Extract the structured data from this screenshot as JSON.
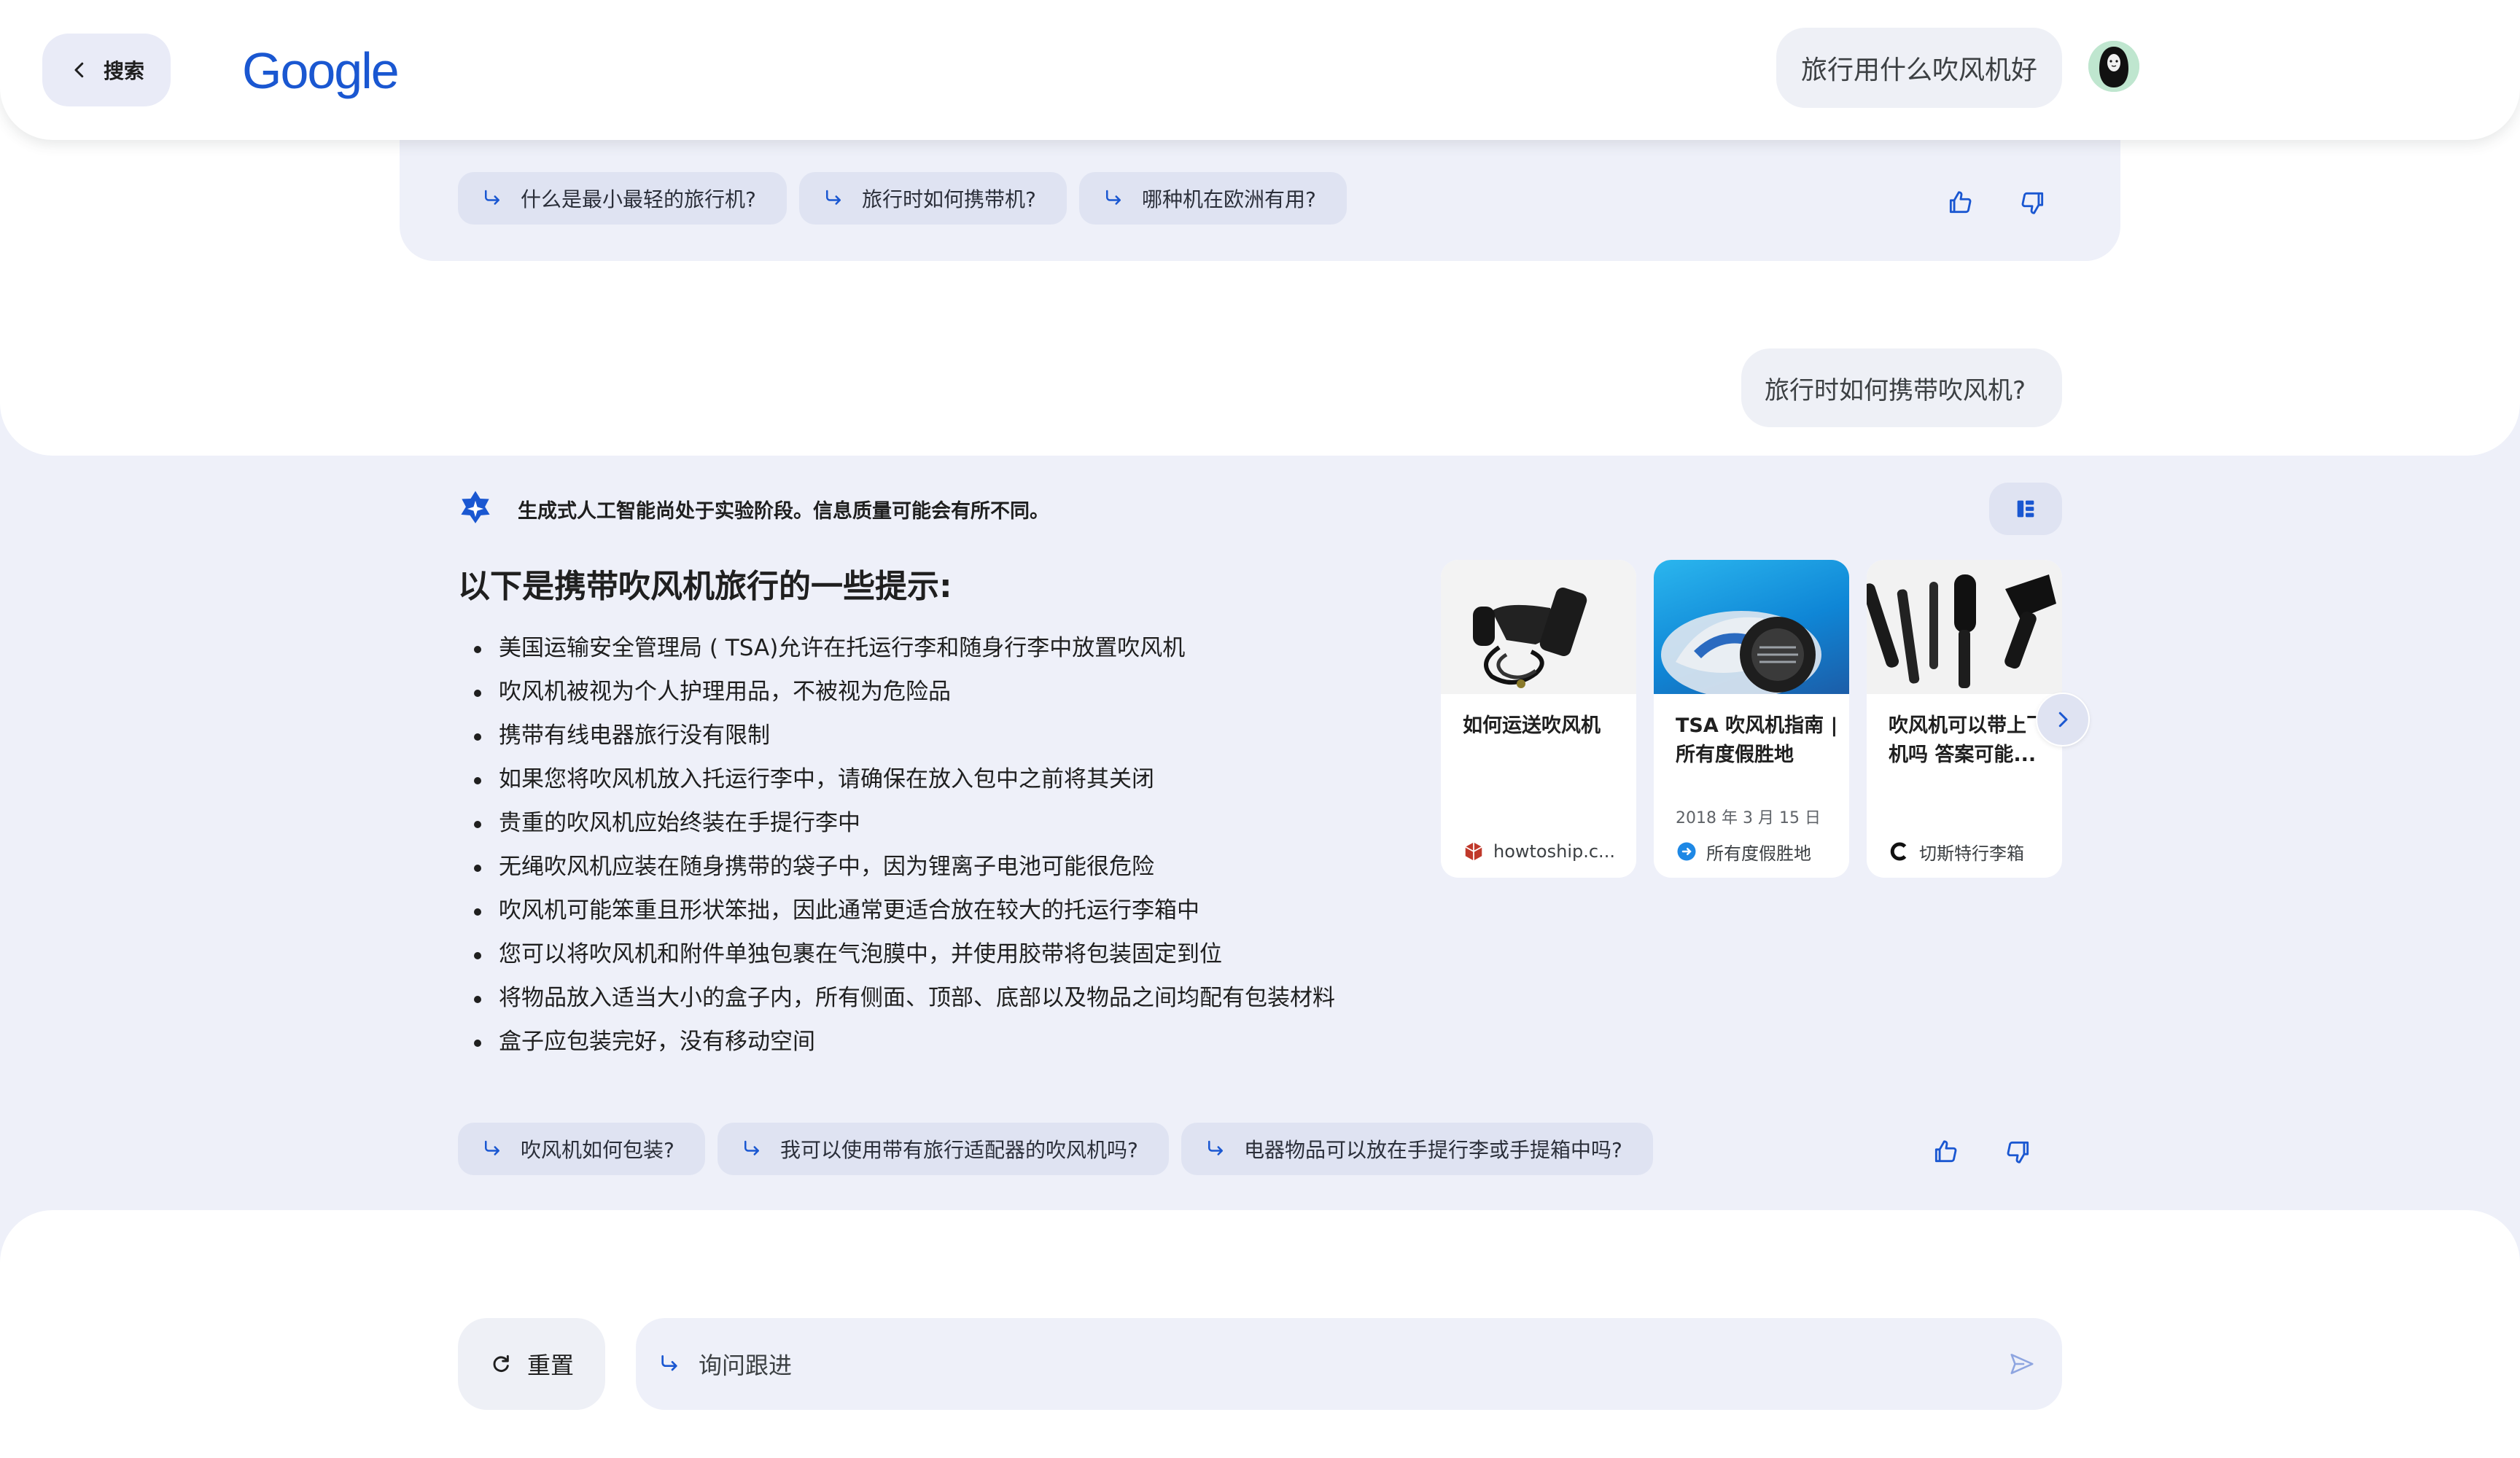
{
  "header": {
    "back_label": "搜索",
    "logo": "Google",
    "query": "旅行用什么吹风机好"
  },
  "prev_answer": {
    "chips": [
      "什么是最小最轻的旅行机?",
      "旅行时如何携带机?",
      "哪种机在欧洲有用?"
    ]
  },
  "user_followup": "旅行时如何携带吹风机?",
  "answer": {
    "disclaimer": "生成式人工智能尚处于实验阶段。信息质量可能会有所不同。",
    "title": "以下是携带吹风机旅行的一些提示:",
    "bullets": [
      "美国运输安全管理局 ( TSA)允许在托运行李和随身行李中放置吹风机",
      "吹风机被视为个人护理用品，不被视为危险品",
      "携带有线电器旅行没有限制",
      "如果您将吹风机放入托运行李中，请确保在放入包中之前将其关闭",
      "贵重的吹风机应始终装在手提行李中",
      "无绳吹风机应装在随身携带的袋子中，因为锂离子电池可能很危险",
      "吹风机可能笨重且形状笨拙，因此通常更适合放在较大的托运行李箱中",
      "您可以将吹风机和附件单独包裹在气泡膜中，并使用胶带将包装固定到位",
      "将物品放入适当大小的盒子内，所有侧面、顶部、底部以及物品之间均配有包装材料",
      "盒子应包装完好，没有移动空间"
    ],
    "sources": [
      {
        "title": "如何运送吹风机",
        "date": "",
        "site": "howtoship.c..."
      },
      {
        "title": "TSA 吹风机指南 | 所有度假胜地",
        "date": "2018 年 3 月 15 日",
        "site": "所有度假胜地"
      },
      {
        "title": "吹风机可以带上飞机吗 答案可能...",
        "date": "",
        "site": "切斯特行李箱"
      }
    ],
    "chips": [
      "吹风机如何包装?",
      "我可以使用带有旅行适配器的吹风机吗?",
      "电器物品可以放在手提行李或手提箱中吗?"
    ]
  },
  "footer": {
    "reset_label": "重置",
    "ask_placeholder": "询问跟进"
  },
  "colors": {
    "accent": "#1a57d1",
    "chip_bg": "#dfe3f2",
    "panel_bg": "#eef0f9"
  }
}
